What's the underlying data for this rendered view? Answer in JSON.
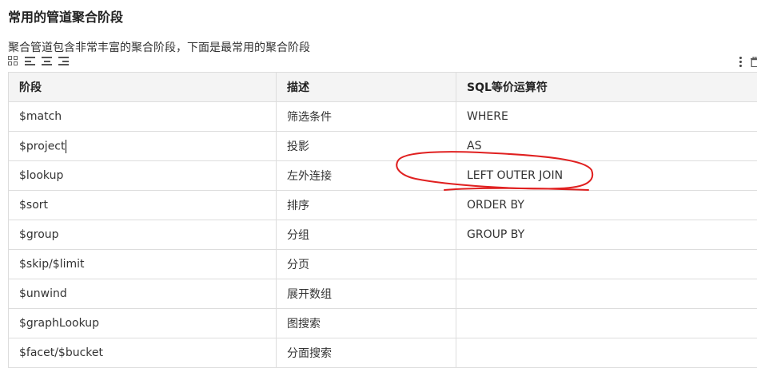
{
  "doc": {
    "heading": "常用的管道聚合阶段",
    "description": "聚合管道包含非常丰富的聚合阶段，下面是最常用的聚合阶段"
  },
  "toolbar": {
    "icons": [
      "grid-icon",
      "align-left-icon",
      "align-center-icon",
      "align-right-icon"
    ],
    "right_icons": [
      "more-vertical-icon",
      "trash-icon"
    ]
  },
  "table": {
    "headers": [
      "阶段",
      "描述",
      "SQL等价运算符"
    ],
    "rows": [
      [
        "$match",
        "筛选条件",
        "WHERE"
      ],
      [
        "$project",
        "投影",
        "AS"
      ],
      [
        "$lookup",
        "左外连接",
        "LEFT OUTER JOIN"
      ],
      [
        "$sort",
        "排序",
        "ORDER BY"
      ],
      [
        "$group",
        "分组",
        "GROUP BY"
      ],
      [
        "$skip/$limit",
        "分页",
        ""
      ],
      [
        "$unwind",
        "展开数组",
        ""
      ],
      [
        "$graphLookup",
        "图搜索",
        ""
      ],
      [
        "$facet/$bucket",
        "分面搜索",
        ""
      ]
    ]
  },
  "annotation": {
    "color": "#e02020"
  }
}
